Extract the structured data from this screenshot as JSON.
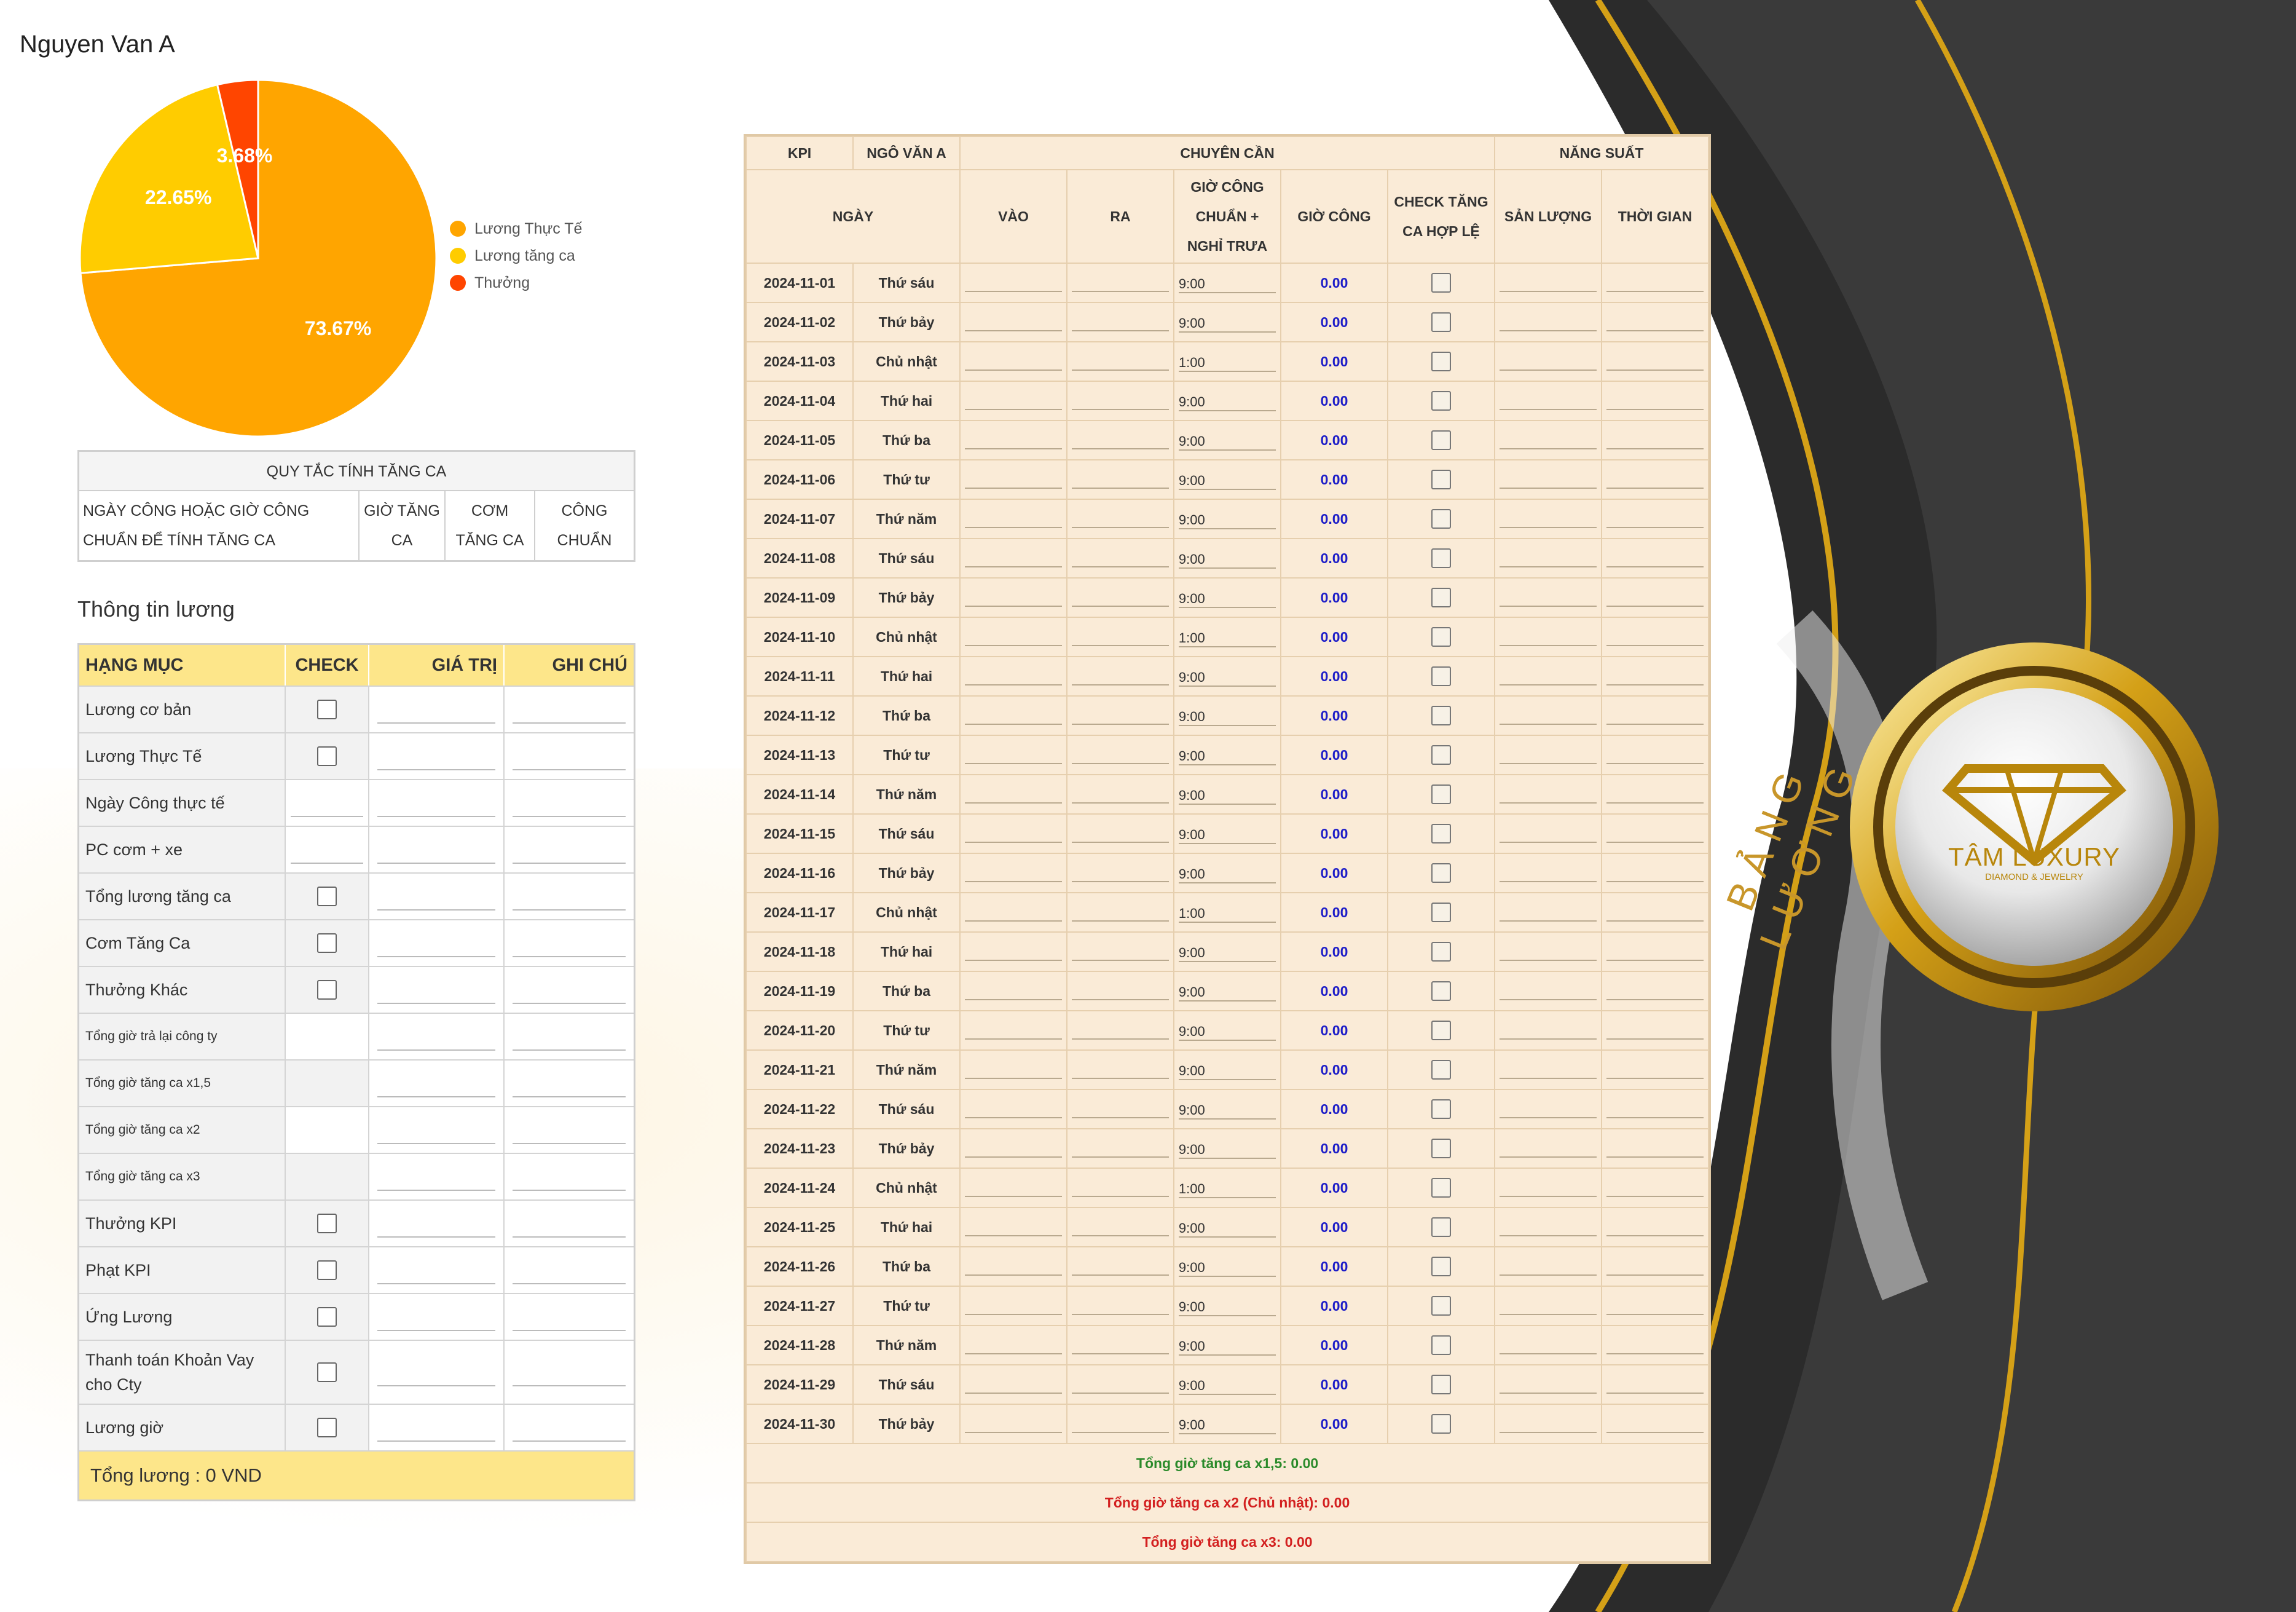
{
  "employee": {
    "name": "Nguyen Van A"
  },
  "chart_data": {
    "type": "pie",
    "labels": [
      "Lương Thực Tế",
      "Lương tăng ca",
      "Thưởng"
    ],
    "values": [
      73.67,
      22.65,
      3.68
    ],
    "value_labels": [
      "73.67%",
      "22.65%",
      "3.68%"
    ],
    "colors": [
      "#FFA500",
      "#FFCC00",
      "#FF4500"
    ],
    "legend_position": "right"
  },
  "overtime_rules": {
    "title": "QUY TẮC TÍNH TĂNG CA",
    "headers": [
      "NGÀY CÔNG HOẶC GIỜ CÔNG CHUẨN ĐỂ TÍNH TĂNG CA",
      "GIỜ TĂNG CA",
      "CƠM TĂNG CA",
      "CÔNG CHUẨN"
    ]
  },
  "salary_info": {
    "section_title": "Thông tin lương",
    "headers": {
      "item": "HẠNG MỤC",
      "check": "CHECK",
      "value": "GIÁ TRỊ",
      "note": "GHI CHÚ"
    },
    "rows": [
      {
        "label": "Lương cơ bản"
      },
      {
        "label": "Lương Thực Tế"
      },
      {
        "label": "Ngày Công thực tế"
      },
      {
        "label": "PC cơm + xe"
      },
      {
        "label": "Tổng lương tăng ca"
      },
      {
        "label": "Cơm Tăng Ca"
      },
      {
        "label": "Thưởng Khác"
      },
      {
        "label": "Tổng giờ trả lại công ty"
      },
      {
        "label": "Tổng giờ tăng ca x1,5"
      },
      {
        "label": "Tổng giờ tăng ca x2"
      },
      {
        "label": "Tổng giờ tăng ca x3"
      },
      {
        "label": "Thưởng KPI"
      },
      {
        "label": "Phạt KPI"
      },
      {
        "label": "Ứng Lương"
      },
      {
        "label": "Thanh toán Khoản Vay cho Cty"
      },
      {
        "label": "Lương giờ"
      }
    ],
    "total": "Tổng lương : 0 VND"
  },
  "timesheet": {
    "top_headers": {
      "kpi": "KPI",
      "name": "NGÔ VĂN A",
      "attendance": "CHUYÊN CẦN",
      "productivity": "NĂNG SUẤT"
    },
    "columns": {
      "date": "NGÀY",
      "in": "VÀO",
      "out": "RA",
      "std_hours": "GIỜ CÔNG CHUẨN + NGHỈ TRƯA",
      "work_hours": "GIỜ CÔNG",
      "ot_check": "CHECK TĂNG CA HỢP LỆ",
      "output": "SẢN LƯỢNG",
      "time": "THỜI GIAN"
    },
    "rows": [
      {
        "date": "2024-11-01",
        "weekday": "Thứ sáu",
        "std": "9:00",
        "hours": "0.00"
      },
      {
        "date": "2024-11-02",
        "weekday": "Thứ bảy",
        "std": "9:00",
        "hours": "0.00"
      },
      {
        "date": "2024-11-03",
        "weekday": "Chủ nhật",
        "std": "1:00",
        "hours": "0.00"
      },
      {
        "date": "2024-11-04",
        "weekday": "Thứ hai",
        "std": "9:00",
        "hours": "0.00"
      },
      {
        "date": "2024-11-05",
        "weekday": "Thứ ba",
        "std": "9:00",
        "hours": "0.00"
      },
      {
        "date": "2024-11-06",
        "weekday": "Thứ tư",
        "std": "9:00",
        "hours": "0.00"
      },
      {
        "date": "2024-11-07",
        "weekday": "Thứ năm",
        "std": "9:00",
        "hours": "0.00"
      },
      {
        "date": "2024-11-08",
        "weekday": "Thứ sáu",
        "std": "9:00",
        "hours": "0.00"
      },
      {
        "date": "2024-11-09",
        "weekday": "Thứ bảy",
        "std": "9:00",
        "hours": "0.00"
      },
      {
        "date": "2024-11-10",
        "weekday": "Chủ nhật",
        "std": "1:00",
        "hours": "0.00"
      },
      {
        "date": "2024-11-11",
        "weekday": "Thứ hai",
        "std": "9:00",
        "hours": "0.00"
      },
      {
        "date": "2024-11-12",
        "weekday": "Thứ ba",
        "std": "9:00",
        "hours": "0.00"
      },
      {
        "date": "2024-11-13",
        "weekday": "Thứ tư",
        "std": "9:00",
        "hours": "0.00"
      },
      {
        "date": "2024-11-14",
        "weekday": "Thứ năm",
        "std": "9:00",
        "hours": "0.00"
      },
      {
        "date": "2024-11-15",
        "weekday": "Thứ sáu",
        "std": "9:00",
        "hours": "0.00"
      },
      {
        "date": "2024-11-16",
        "weekday": "Thứ bảy",
        "std": "9:00",
        "hours": "0.00"
      },
      {
        "date": "2024-11-17",
        "weekday": "Chủ nhật",
        "std": "1:00",
        "hours": "0.00"
      },
      {
        "date": "2024-11-18",
        "weekday": "Thứ hai",
        "std": "9:00",
        "hours": "0.00"
      },
      {
        "date": "2024-11-19",
        "weekday": "Thứ ba",
        "std": "9:00",
        "hours": "0.00"
      },
      {
        "date": "2024-11-20",
        "weekday": "Thứ tư",
        "std": "9:00",
        "hours": "0.00"
      },
      {
        "date": "2024-11-21",
        "weekday": "Thứ năm",
        "std": "9:00",
        "hours": "0.00"
      },
      {
        "date": "2024-11-22",
        "weekday": "Thứ sáu",
        "std": "9:00",
        "hours": "0.00"
      },
      {
        "date": "2024-11-23",
        "weekday": "Thứ bảy",
        "std": "9:00",
        "hours": "0.00"
      },
      {
        "date": "2024-11-24",
        "weekday": "Chủ nhật",
        "std": "1:00",
        "hours": "0.00"
      },
      {
        "date": "2024-11-25",
        "weekday": "Thứ hai",
        "std": "9:00",
        "hours": "0.00"
      },
      {
        "date": "2024-11-26",
        "weekday": "Thứ ba",
        "std": "9:00",
        "hours": "0.00"
      },
      {
        "date": "2024-11-27",
        "weekday": "Thứ tư",
        "std": "9:00",
        "hours": "0.00"
      },
      {
        "date": "2024-11-28",
        "weekday": "Thứ năm",
        "std": "9:00",
        "hours": "0.00"
      },
      {
        "date": "2024-11-29",
        "weekday": "Thứ sáu",
        "std": "9:00",
        "hours": "0.00"
      },
      {
        "date": "2024-11-30",
        "weekday": "Thứ bảy",
        "std": "9:00",
        "hours": "0.00"
      }
    ],
    "summary": [
      {
        "text": "Tổng giờ tăng ca x1,5: 0.00",
        "color": "green"
      },
      {
        "text": "Tổng giờ tăng ca x2 (Chủ nhật): 0.00",
        "color": "red"
      },
      {
        "text": "Tổng giờ tăng ca x3: 0.00",
        "color": "red"
      }
    ]
  },
  "branding": {
    "brand_name": "TÂM LUXURY",
    "brand_tagline": "DIAMOND & JEWELRY",
    "arc_text": "BẢNG LƯƠNG",
    "colors": {
      "gold": "#D4A017",
      "dark": "#2b2b2b"
    }
  }
}
